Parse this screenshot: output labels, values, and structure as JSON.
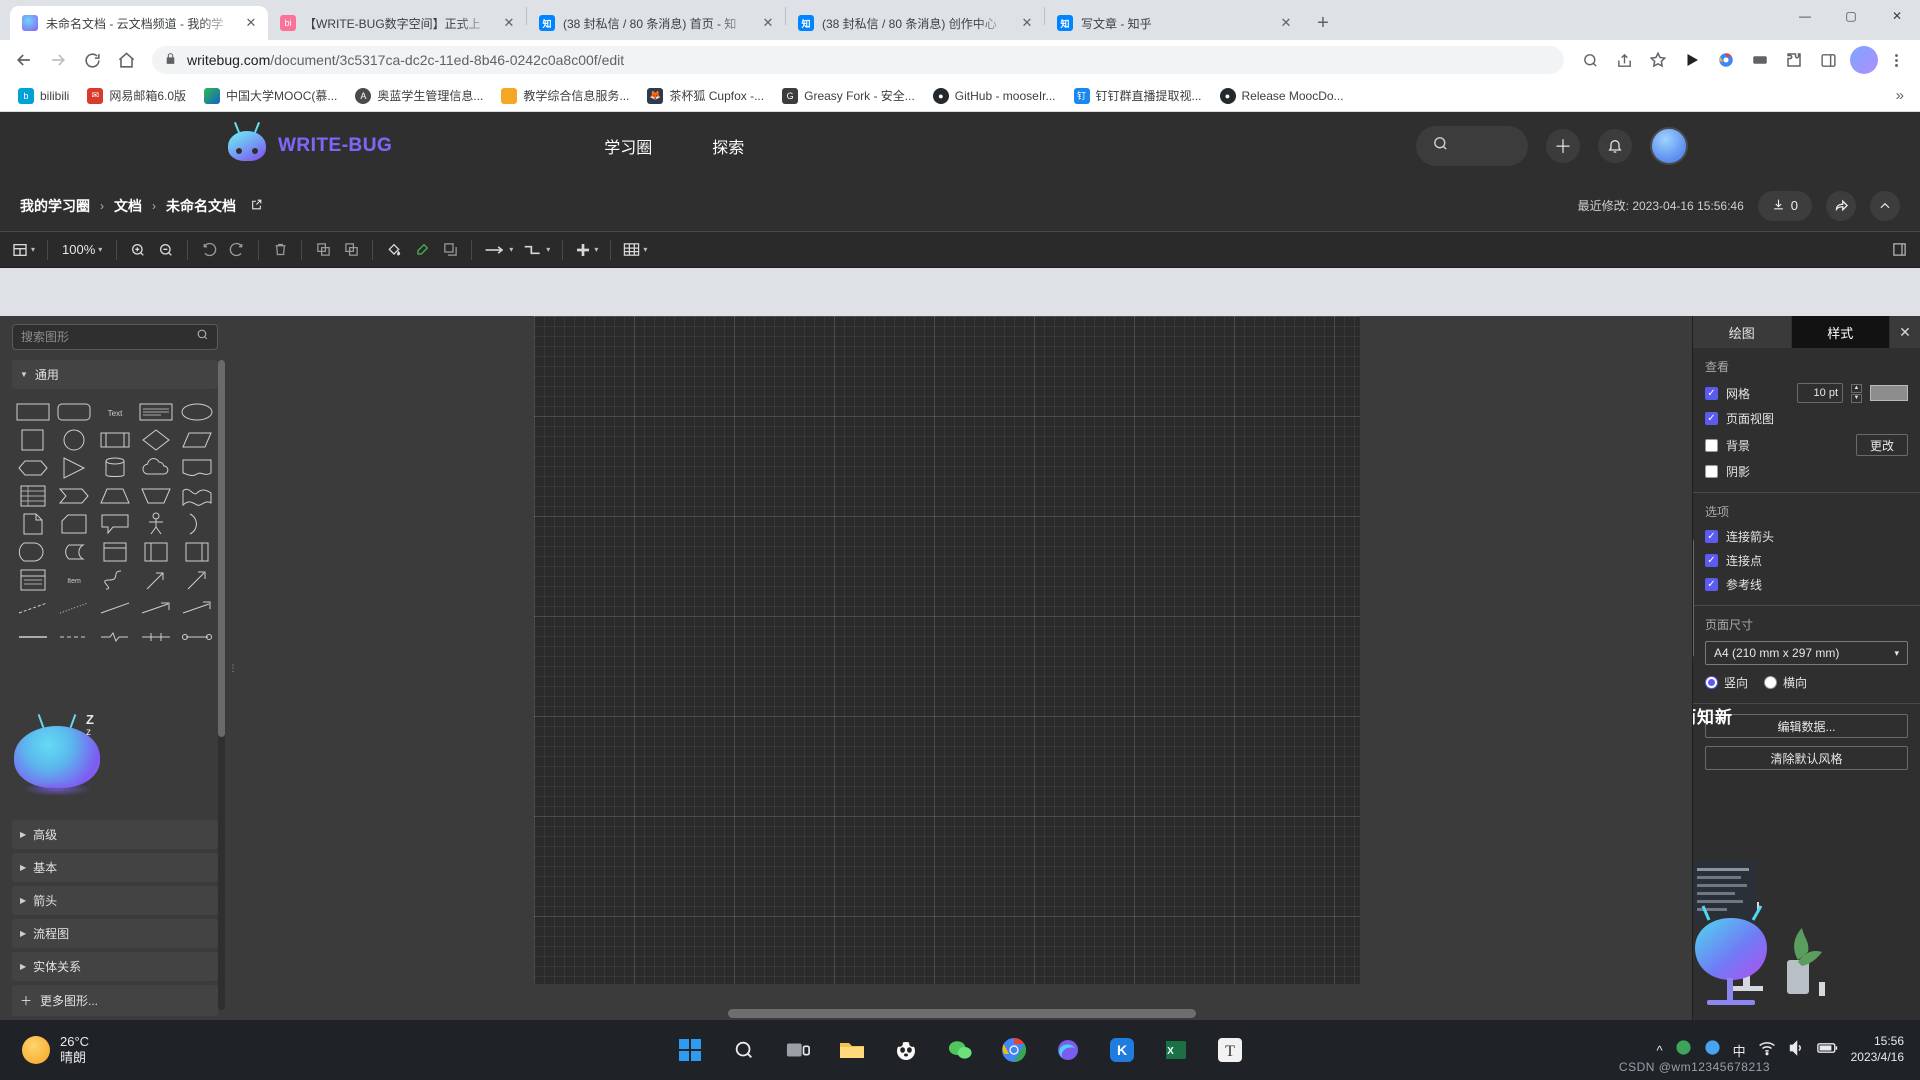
{
  "browser": {
    "tabs": [
      {
        "title": "未命名文档 - 云文档频道 - 我的学",
        "favicon": "writebug-icon",
        "active": true
      },
      {
        "title": "【WRITE-BUG数字空间】正式上",
        "favicon": "bilibili-icon",
        "active": false
      },
      {
        "title": "(38 封私信 / 80 条消息) 首页 - 知",
        "favicon": "zhihu-icon",
        "active": false
      },
      {
        "title": "(38 封私信 / 80 条消息) 创作中心",
        "favicon": "zhihu-icon",
        "active": false
      },
      {
        "title": "写文章 - 知乎",
        "favicon": "zhihu-icon",
        "active": false
      }
    ],
    "new_tab_label": "+",
    "window_controls": {
      "minimize": "—",
      "maximize": "▢",
      "close": "✕"
    },
    "nav": {
      "back": "←",
      "forward": "→",
      "reload": "⟳",
      "home": "⌂"
    },
    "omnibox": {
      "lock_icon": "lock-icon",
      "url_domain": "writebug.com",
      "url_path": "/document/3c5317ca-dc2c-11ed-8b46-0242c0a8c00f/edit"
    },
    "toolbar_icons": [
      "zoom-icon",
      "share-icon",
      "star-icon",
      "media-icon",
      "extension-icon",
      "sidepanel-icon",
      "menu-icon"
    ],
    "bookmarks": [
      {
        "label": "bilibili",
        "icon": "bilibili-icon",
        "color": "#00a1d6"
      },
      {
        "label": "网易邮箱6.0版",
        "icon": "netease-mail-icon",
        "color": "#d93a2b"
      },
      {
        "label": "中国大学MOOC(慕...",
        "icon": "mooc-icon",
        "color": "#2db84d"
      },
      {
        "label": "奥蓝学生管理信息...",
        "icon": "aolan-icon",
        "color": "#4a4a4a"
      },
      {
        "label": "教学综合信息服务...",
        "icon": "teaching-icon",
        "color": "#f5a623"
      },
      {
        "label": "茶杯狐 Cupfox -...",
        "icon": "cupfox-icon",
        "color": "#2f6fd0"
      },
      {
        "label": "Greasy Fork - 安全...",
        "icon": "greasyfork-icon",
        "color": "#3d3d3d"
      },
      {
        "label": "GitHub - mooseIr...",
        "icon": "github-icon",
        "color": "#24292e"
      },
      {
        "label": "钉钉群直播提取视...",
        "icon": "dingtalk-icon",
        "color": "#1b88ee"
      },
      {
        "label": "Release MoocDo...",
        "icon": "github-icon",
        "color": "#24292e"
      }
    ],
    "bookmarks_overflow": "»"
  },
  "site_header": {
    "brand": "WRITE-BUG",
    "logo_icon": "writebug-bug-logo",
    "nav": [
      {
        "label": "学习圈"
      },
      {
        "label": "探索"
      }
    ],
    "search_icon": "search-icon",
    "add_icon": "plus-icon",
    "bell_icon": "bell-icon",
    "avatar": "user-avatar"
  },
  "breadcrumb": {
    "items": [
      "我的学习圈",
      "文档",
      "未命名文档"
    ],
    "separator": "›",
    "edit_icon": "edit-square-icon",
    "modified_label": "最近修改:",
    "modified_value": "2023-04-16 15:56:46",
    "download_count": "0",
    "download_icon": "download-icon",
    "share_icon": "share-arrow-icon",
    "collapse_icon": "chevron-up-icon"
  },
  "diagram_toolbar": {
    "view_icon": "layout-icon",
    "zoom_value": "100%",
    "zoom_in_icon": "zoom-in-icon",
    "zoom_out_icon": "zoom-out-icon",
    "undo_icon": "undo-icon",
    "redo_icon": "redo-icon",
    "delete_icon": "trash-icon",
    "to_front_icon": "bring-to-front-icon",
    "to_back_icon": "send-to-back-icon",
    "fill_icon": "fill-color-icon",
    "line_icon": "line-color-icon",
    "shadow_icon": "shadow-icon",
    "connection_icon": "connection-arrow-icon",
    "waypoint_icon": "waypoint-icon",
    "insert_icon": "plus-icon",
    "table_icon": "table-icon",
    "format_panel_icon": "format-panel-icon",
    "caret": "▾"
  },
  "shape_palette": {
    "search_placeholder": "搜索图形",
    "search_icon": "search-icon",
    "search_value": "",
    "sections": [
      {
        "label": "通用",
        "expanded": true
      },
      {
        "label": "高级",
        "expanded": false
      },
      {
        "label": "基本",
        "expanded": false
      },
      {
        "label": "箭头",
        "expanded": false
      },
      {
        "label": "流程图",
        "expanded": false
      },
      {
        "label": "实体关系",
        "expanded": false
      }
    ],
    "more_shapes": "更多图形...",
    "more_icon": "plus-icon"
  },
  "format_panel": {
    "tabs": [
      {
        "label": "绘图",
        "active": false
      },
      {
        "label": "样式",
        "active": true
      }
    ],
    "close_icon": "close-icon",
    "view_group": {
      "title": "查看",
      "grid": {
        "label": "网格",
        "checked": true,
        "size_value": "10 pt",
        "color": "#8d8d8d"
      },
      "page_view": {
        "label": "页面视图",
        "checked": true
      },
      "background": {
        "label": "背景",
        "checked": false,
        "button": "更改"
      },
      "shadow": {
        "label": "阴影",
        "checked": false
      }
    },
    "options_group": {
      "title": "选项",
      "items": [
        {
          "label": "连接箭头",
          "checked": true
        },
        {
          "label": "连接点",
          "checked": true
        },
        {
          "label": "参考线",
          "checked": true
        }
      ]
    },
    "page_size_group": {
      "title": "页面尺寸",
      "selected": "A4 (210 mm x 297 mm)",
      "chevron": "▾",
      "orientation": [
        {
          "label": "竖向",
          "selected": true
        },
        {
          "label": "横向",
          "selected": false
        }
      ]
    },
    "buttons": [
      {
        "label": "编辑数据..."
      },
      {
        "label": "清除默认风格"
      }
    ],
    "watermark": "温故而知新"
  },
  "taskbar": {
    "weather": {
      "temp": "26°C",
      "condition": "晴朗",
      "icon": "sun-icon"
    },
    "items": [
      {
        "name": "start-button",
        "icon": "windows-icon"
      },
      {
        "name": "search-button",
        "icon": "search-icon"
      },
      {
        "name": "task-view-button",
        "icon": "task-view-icon"
      },
      {
        "name": "file-explorer",
        "icon": "folder-icon"
      },
      {
        "name": "app-panda",
        "icon": "panda-icon"
      },
      {
        "name": "app-wechat",
        "icon": "wechat-icon"
      },
      {
        "name": "chrome",
        "icon": "chrome-icon"
      },
      {
        "name": "app-edge-dev",
        "icon": "browser-icon"
      },
      {
        "name": "app-kuaishou",
        "icon": "k-icon"
      },
      {
        "name": "app-excel",
        "icon": "excel-icon"
      },
      {
        "name": "app-typora",
        "icon": "typora-icon"
      }
    ],
    "tray": {
      "expand": "^",
      "icons": [
        "wifi-icon",
        "speaker-icon",
        "battery-icon"
      ],
      "ime": "中",
      "time": "15:56",
      "date": "2023/4/16"
    },
    "watermark": "CSDN @wm12345678213"
  }
}
